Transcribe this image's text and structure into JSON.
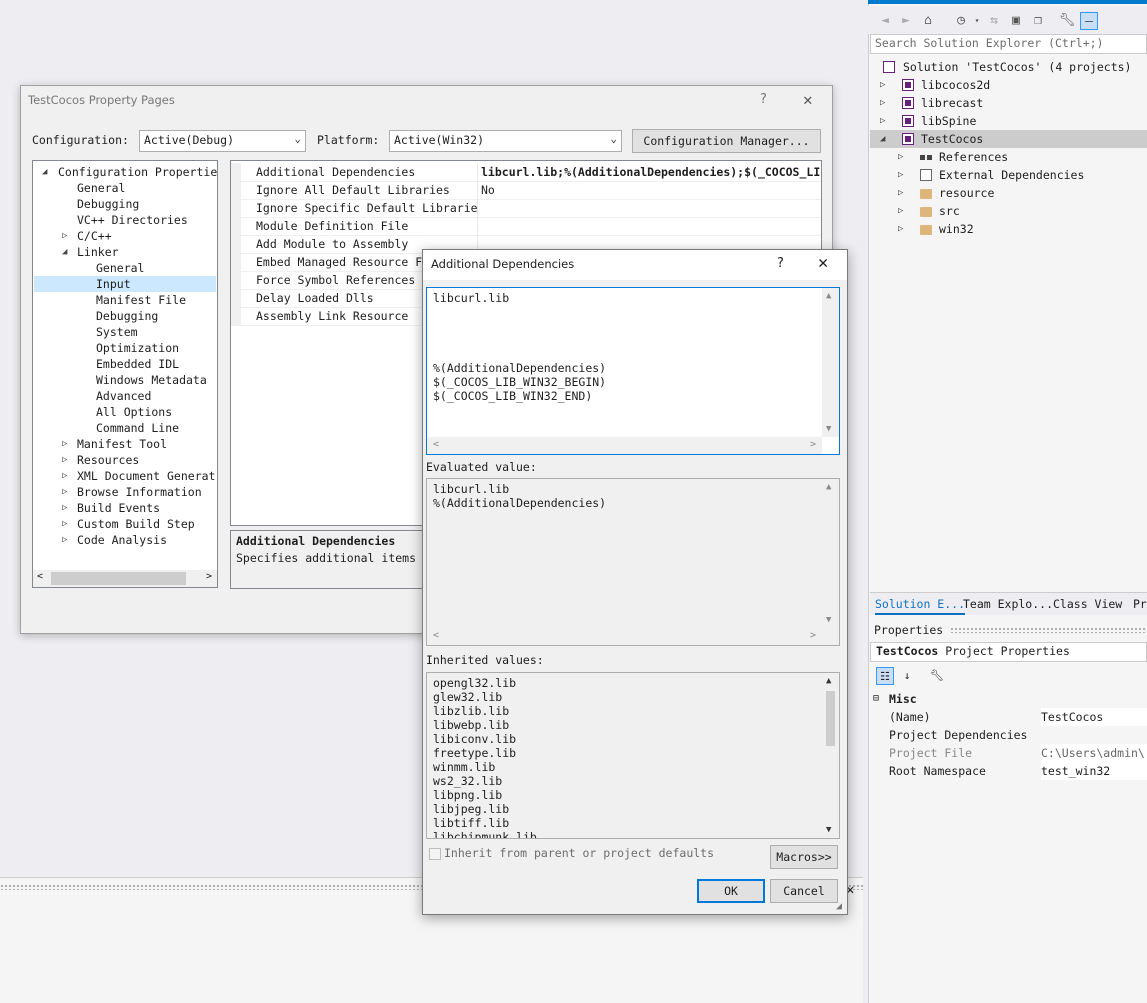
{
  "solution_explorer": {
    "search_placeholder": "Search Solution Explorer (Ctrl+;)",
    "items": [
      {
        "label": "Solution 'TestCocos' (4 projects)",
        "icon": "solution-icon"
      },
      {
        "label": "libcocos2d",
        "icon": "project-icon"
      },
      {
        "label": "librecast",
        "icon": "project-icon"
      },
      {
        "label": "libSpine",
        "icon": "project-icon"
      },
      {
        "label": "TestCocos",
        "icon": "project-icon"
      },
      {
        "label": "References",
        "icon": "references-icon"
      },
      {
        "label": "External Dependencies",
        "icon": "external-dependencies-icon"
      },
      {
        "label": "resource",
        "icon": "folder-icon"
      },
      {
        "label": "src",
        "icon": "folder-icon"
      },
      {
        "label": "win32",
        "icon": "folder-icon"
      }
    ],
    "tabs": [
      "Solution E...",
      "Team Explo...",
      "Class View",
      "Pr"
    ]
  },
  "properties_panel": {
    "title": "Properties",
    "target_name": "TestCocos",
    "target_type": "Project Properties",
    "category": "Misc",
    "rows": [
      {
        "name": "(Name)",
        "value": "TestCocos"
      },
      {
        "name": "Project Dependencies",
        "value": ""
      },
      {
        "name": "Project File",
        "value": "C:\\Users\\admin\\"
      },
      {
        "name": "Root Namespace",
        "value": "test_win32"
      }
    ]
  },
  "property_pages": {
    "title": "TestCocos Property Pages",
    "help": "?",
    "configuration_label": "Configuration:",
    "configuration_value": "Active(Debug)",
    "platform_label": "Platform:",
    "platform_value": "Active(Win32)",
    "config_manager_button": "Configuration Manager...",
    "tree": {
      "root": "Configuration Properties",
      "general": "General",
      "debugging": "Debugging",
      "vc_dirs": "VC++ Directories",
      "cpp": "C/C++",
      "linker": "Linker",
      "linker_children": [
        "General",
        "Input",
        "Manifest File",
        "Debugging",
        "System",
        "Optimization",
        "Embedded IDL",
        "Windows Metadata",
        "Advanced",
        "All Options",
        "Command Line"
      ],
      "after": [
        "Manifest Tool",
        "Resources",
        "XML Document Generat",
        "Browse Information",
        "Build Events",
        "Custom Build Step",
        "Code Analysis"
      ]
    },
    "grid_rows": [
      {
        "name": "Additional Dependencies",
        "value": "libcurl.lib;%(AdditionalDependencies);$(_COCOS_LI"
      },
      {
        "name": "Ignore All Default Libraries",
        "value": "No"
      },
      {
        "name": "Ignore Specific Default Librarie",
        "value": ""
      },
      {
        "name": "Module Definition File",
        "value": ""
      },
      {
        "name": "Add Module to Assembly",
        "value": ""
      },
      {
        "name": "Embed Managed Resource F",
        "value": ""
      },
      {
        "name": "Force Symbol References",
        "value": ""
      },
      {
        "name": "Delay Loaded Dlls",
        "value": ""
      },
      {
        "name": "Assembly Link Resource",
        "value": ""
      }
    ],
    "description_title": "Additional Dependencies",
    "description_text": "Specifies additional items"
  },
  "additional_dependencies": {
    "title": "Additional Dependencies",
    "help": "?",
    "edit_lines": [
      "libcurl.lib",
      "",
      "",
      "",
      "",
      "%(AdditionalDependencies)",
      "$(_COCOS_LIB_WIN32_BEGIN)",
      "$(_COCOS_LIB_WIN32_END)"
    ],
    "evaluated_label": "Evaluated value:",
    "evaluated_lines": [
      "libcurl.lib",
      "%(AdditionalDependencies)"
    ],
    "inherited_label": "Inherited values:",
    "inherited_lines": [
      "opengl32.lib",
      "glew32.lib",
      "libzlib.lib",
      "libwebp.lib",
      "libiconv.lib",
      "freetype.lib",
      "winmm.lib",
      "ws2_32.lib",
      "libpng.lib",
      "libjpeg.lib",
      "libtiff.lib",
      "libchipmunk.lib"
    ],
    "inherit_checkbox_label": "Inherit from parent or project defaults",
    "inherit_checked": false,
    "macros_button": "Macros>>",
    "ok_button": "OK",
    "cancel_button": "Cancel"
  }
}
